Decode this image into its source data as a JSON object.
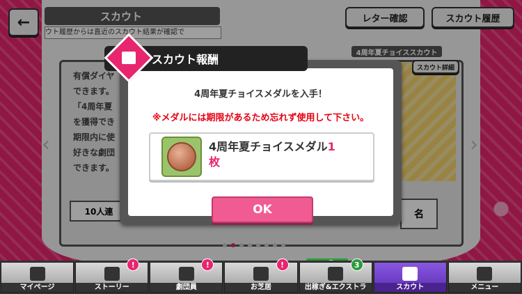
{
  "header": {
    "back_icon": "back-arrow-icon",
    "title": "スカウト",
    "ticker": "ウト履歴からは直近のスカウト結果が確認で",
    "letter_button": "レター確認",
    "history_button": "スカウト履歴"
  },
  "background_panel": {
    "banner_label": "4周年夏チョイススカウト",
    "detail_button": "スカウト詳細",
    "text_lines": [
      "有償ダイヤ",
      "できます。",
      "「4周年夏",
      "を獲得でき",
      "期限内に使",
      "好きな劇団",
      "できます。"
    ],
    "button_left": "10人連",
    "button_right": "名"
  },
  "pager": {
    "count": 8,
    "active_index": 1
  },
  "dialog": {
    "title": "スカウト報酬",
    "message": "4周年夏チョイスメダルを入手！",
    "warning": "※メダルには期限があるため忘れず使用して下さい。",
    "item_name": "4周年夏チョイスメダル",
    "item_quantity": "1",
    "item_unit": "枚",
    "ok_button": "OK"
  },
  "nav": {
    "coin_tag": "コイン量UP",
    "items": [
      {
        "label": "マイページ",
        "icon": "home-icon",
        "alert": ""
      },
      {
        "label": "ストーリー",
        "icon": "book-icon",
        "alert": "!"
      },
      {
        "label": "劇団員",
        "icon": "ribbon-icon",
        "alert": "!"
      },
      {
        "label": "お芝居",
        "icon": "theater-icon",
        "alert": "!"
      },
      {
        "label": "出稼ぎ&エクストラ",
        "icon": "coin-icon",
        "alert": "3"
      },
      {
        "label": "スカウト",
        "icon": "star-icon",
        "alert": ""
      },
      {
        "label": "メニュー",
        "icon": "grid-icon",
        "alert": ""
      }
    ]
  },
  "colors": {
    "accent": "#e8256f",
    "warning": "#e60012",
    "active_nav": "#6b3fc8"
  }
}
